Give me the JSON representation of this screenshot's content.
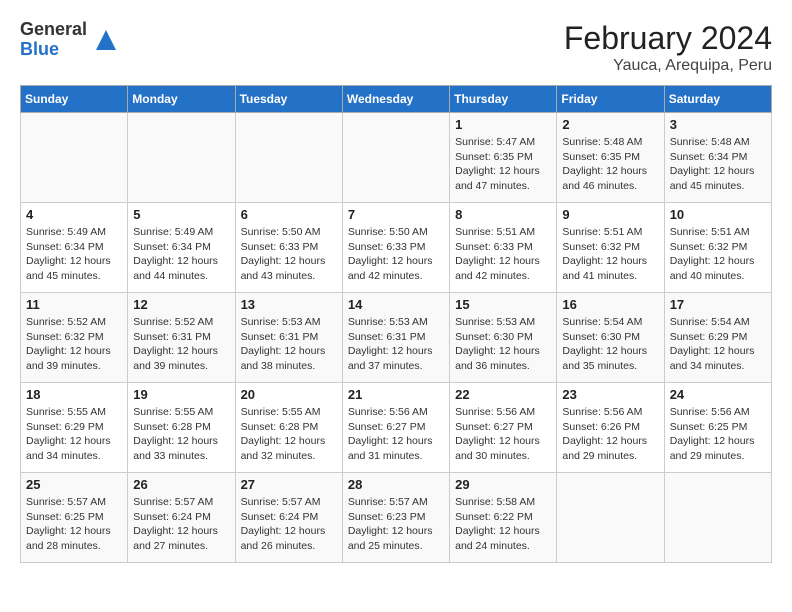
{
  "header": {
    "logo": {
      "general": "General",
      "blue": "Blue"
    },
    "title": "February 2024",
    "subtitle": "Yauca, Arequipa, Peru"
  },
  "weekdays": [
    "Sunday",
    "Monday",
    "Tuesday",
    "Wednesday",
    "Thursday",
    "Friday",
    "Saturday"
  ],
  "weeks": [
    [
      {
        "day": "",
        "sunrise": "",
        "sunset": "",
        "daylight": ""
      },
      {
        "day": "",
        "sunrise": "",
        "sunset": "",
        "daylight": ""
      },
      {
        "day": "",
        "sunrise": "",
        "sunset": "",
        "daylight": ""
      },
      {
        "day": "",
        "sunrise": "",
        "sunset": "",
        "daylight": ""
      },
      {
        "day": "1",
        "sunrise": "Sunrise: 5:47 AM",
        "sunset": "Sunset: 6:35 PM",
        "daylight": "Daylight: 12 hours and 47 minutes."
      },
      {
        "day": "2",
        "sunrise": "Sunrise: 5:48 AM",
        "sunset": "Sunset: 6:35 PM",
        "daylight": "Daylight: 12 hours and 46 minutes."
      },
      {
        "day": "3",
        "sunrise": "Sunrise: 5:48 AM",
        "sunset": "Sunset: 6:34 PM",
        "daylight": "Daylight: 12 hours and 45 minutes."
      }
    ],
    [
      {
        "day": "4",
        "sunrise": "Sunrise: 5:49 AM",
        "sunset": "Sunset: 6:34 PM",
        "daylight": "Daylight: 12 hours and 45 minutes."
      },
      {
        "day": "5",
        "sunrise": "Sunrise: 5:49 AM",
        "sunset": "Sunset: 6:34 PM",
        "daylight": "Daylight: 12 hours and 44 minutes."
      },
      {
        "day": "6",
        "sunrise": "Sunrise: 5:50 AM",
        "sunset": "Sunset: 6:33 PM",
        "daylight": "Daylight: 12 hours and 43 minutes."
      },
      {
        "day": "7",
        "sunrise": "Sunrise: 5:50 AM",
        "sunset": "Sunset: 6:33 PM",
        "daylight": "Daylight: 12 hours and 42 minutes."
      },
      {
        "day": "8",
        "sunrise": "Sunrise: 5:51 AM",
        "sunset": "Sunset: 6:33 PM",
        "daylight": "Daylight: 12 hours and 42 minutes."
      },
      {
        "day": "9",
        "sunrise": "Sunrise: 5:51 AM",
        "sunset": "Sunset: 6:32 PM",
        "daylight": "Daylight: 12 hours and 41 minutes."
      },
      {
        "day": "10",
        "sunrise": "Sunrise: 5:51 AM",
        "sunset": "Sunset: 6:32 PM",
        "daylight": "Daylight: 12 hours and 40 minutes."
      }
    ],
    [
      {
        "day": "11",
        "sunrise": "Sunrise: 5:52 AM",
        "sunset": "Sunset: 6:32 PM",
        "daylight": "Daylight: 12 hours and 39 minutes."
      },
      {
        "day": "12",
        "sunrise": "Sunrise: 5:52 AM",
        "sunset": "Sunset: 6:31 PM",
        "daylight": "Daylight: 12 hours and 39 minutes."
      },
      {
        "day": "13",
        "sunrise": "Sunrise: 5:53 AM",
        "sunset": "Sunset: 6:31 PM",
        "daylight": "Daylight: 12 hours and 38 minutes."
      },
      {
        "day": "14",
        "sunrise": "Sunrise: 5:53 AM",
        "sunset": "Sunset: 6:31 PM",
        "daylight": "Daylight: 12 hours and 37 minutes."
      },
      {
        "day": "15",
        "sunrise": "Sunrise: 5:53 AM",
        "sunset": "Sunset: 6:30 PM",
        "daylight": "Daylight: 12 hours and 36 minutes."
      },
      {
        "day": "16",
        "sunrise": "Sunrise: 5:54 AM",
        "sunset": "Sunset: 6:30 PM",
        "daylight": "Daylight: 12 hours and 35 minutes."
      },
      {
        "day": "17",
        "sunrise": "Sunrise: 5:54 AM",
        "sunset": "Sunset: 6:29 PM",
        "daylight": "Daylight: 12 hours and 34 minutes."
      }
    ],
    [
      {
        "day": "18",
        "sunrise": "Sunrise: 5:55 AM",
        "sunset": "Sunset: 6:29 PM",
        "daylight": "Daylight: 12 hours and 34 minutes."
      },
      {
        "day": "19",
        "sunrise": "Sunrise: 5:55 AM",
        "sunset": "Sunset: 6:28 PM",
        "daylight": "Daylight: 12 hours and 33 minutes."
      },
      {
        "day": "20",
        "sunrise": "Sunrise: 5:55 AM",
        "sunset": "Sunset: 6:28 PM",
        "daylight": "Daylight: 12 hours and 32 minutes."
      },
      {
        "day": "21",
        "sunrise": "Sunrise: 5:56 AM",
        "sunset": "Sunset: 6:27 PM",
        "daylight": "Daylight: 12 hours and 31 minutes."
      },
      {
        "day": "22",
        "sunrise": "Sunrise: 5:56 AM",
        "sunset": "Sunset: 6:27 PM",
        "daylight": "Daylight: 12 hours and 30 minutes."
      },
      {
        "day": "23",
        "sunrise": "Sunrise: 5:56 AM",
        "sunset": "Sunset: 6:26 PM",
        "daylight": "Daylight: 12 hours and 29 minutes."
      },
      {
        "day": "24",
        "sunrise": "Sunrise: 5:56 AM",
        "sunset": "Sunset: 6:25 PM",
        "daylight": "Daylight: 12 hours and 29 minutes."
      }
    ],
    [
      {
        "day": "25",
        "sunrise": "Sunrise: 5:57 AM",
        "sunset": "Sunset: 6:25 PM",
        "daylight": "Daylight: 12 hours and 28 minutes."
      },
      {
        "day": "26",
        "sunrise": "Sunrise: 5:57 AM",
        "sunset": "Sunset: 6:24 PM",
        "daylight": "Daylight: 12 hours and 27 minutes."
      },
      {
        "day": "27",
        "sunrise": "Sunrise: 5:57 AM",
        "sunset": "Sunset: 6:24 PM",
        "daylight": "Daylight: 12 hours and 26 minutes."
      },
      {
        "day": "28",
        "sunrise": "Sunrise: 5:57 AM",
        "sunset": "Sunset: 6:23 PM",
        "daylight": "Daylight: 12 hours and 25 minutes."
      },
      {
        "day": "29",
        "sunrise": "Sunrise: 5:58 AM",
        "sunset": "Sunset: 6:22 PM",
        "daylight": "Daylight: 12 hours and 24 minutes."
      },
      {
        "day": "",
        "sunrise": "",
        "sunset": "",
        "daylight": ""
      },
      {
        "day": "",
        "sunrise": "",
        "sunset": "",
        "daylight": ""
      }
    ]
  ]
}
